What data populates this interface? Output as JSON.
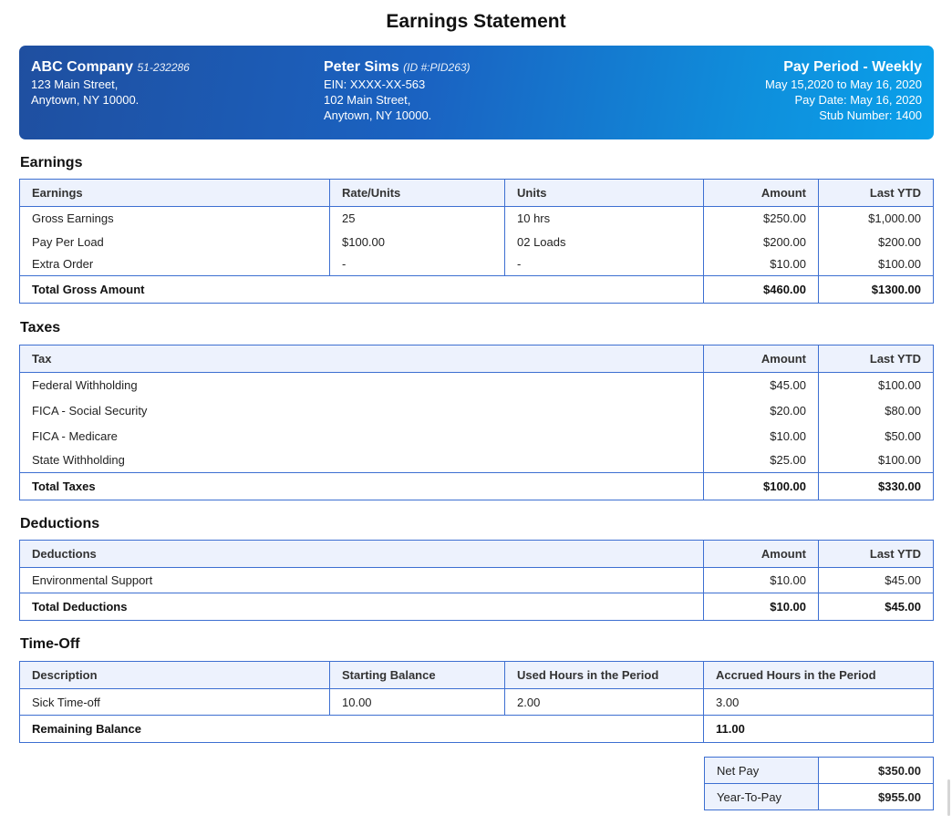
{
  "title": "Earnings Statement",
  "employer": {
    "name": "ABC Company",
    "id": "51-232286",
    "address1": "123 Main Street,",
    "address2": "Anytown, NY 10000."
  },
  "employee": {
    "name": "Peter Sims",
    "id": "(ID #:PID263)",
    "ein": "EIN: XXXX-XX-563",
    "address1": "102 Main Street,",
    "address2": "Anytown, NY 10000."
  },
  "pay": {
    "period_title": "Pay Period - Weekly",
    "period_range": "May 15,2020 to May 16, 2020",
    "pay_date": "Pay Date: May 16, 2020",
    "stub_number": "Stub Number: 1400"
  },
  "colors": {
    "banner_start": "#1f4fa0",
    "banner_end": "#0aa0ea",
    "border": "#3d6fd1",
    "header_bg": "#edf2fd"
  },
  "earnings": {
    "section_title": "Earnings",
    "headers": [
      "Earnings",
      "Rate/Units",
      "Units",
      "Amount",
      "Last YTD"
    ],
    "rows": [
      [
        "Gross Earnings",
        "25",
        "10 hrs",
        "$250.00",
        "$1,000.00"
      ],
      [
        "Pay Per Load",
        "$100.00",
        "02 Loads",
        "$200.00",
        "$200.00"
      ],
      [
        "Extra Order",
        "-",
        "-",
        "$10.00",
        "$100.00"
      ]
    ],
    "total": {
      "label": "Total Gross Amount",
      "amount": "$460.00",
      "ytd": "$1300.00"
    }
  },
  "taxes": {
    "section_title": "Taxes",
    "headers": [
      "Tax",
      "Amount",
      "Last YTD"
    ],
    "rows": [
      [
        "Federal Withholding",
        "$45.00",
        "$100.00"
      ],
      [
        "FICA - Social Security",
        "$20.00",
        "$80.00"
      ],
      [
        "FICA - Medicare",
        "$10.00",
        "$50.00"
      ],
      [
        "State Withholding",
        "$25.00",
        "$100.00"
      ]
    ],
    "total": {
      "label": "Total Taxes",
      "amount": "$100.00",
      "ytd": "$330.00"
    }
  },
  "deductions": {
    "section_title": "Deductions",
    "headers": [
      "Deductions",
      "Amount",
      "Last YTD"
    ],
    "rows": [
      [
        "Environmental Support",
        "$10.00",
        "$45.00"
      ]
    ],
    "total": {
      "label": "Total Deductions",
      "amount": "$10.00",
      "ytd": "$45.00"
    }
  },
  "timeoff": {
    "section_title": "Time-Off",
    "headers": [
      "Description",
      "Starting Balance",
      "Used Hours in the Period",
      "Accrued Hours in the Period"
    ],
    "rows": [
      [
        "Sick Time-off",
        "10.00",
        "2.00",
        "3.00"
      ]
    ],
    "total": {
      "label": "Remaining Balance",
      "value": "11.00"
    }
  },
  "summary": {
    "net_pay_label": "Net Pay",
    "net_pay_value": "$350.00",
    "ytp_label": "Year-To-Pay",
    "ytp_value": "$955.00"
  }
}
